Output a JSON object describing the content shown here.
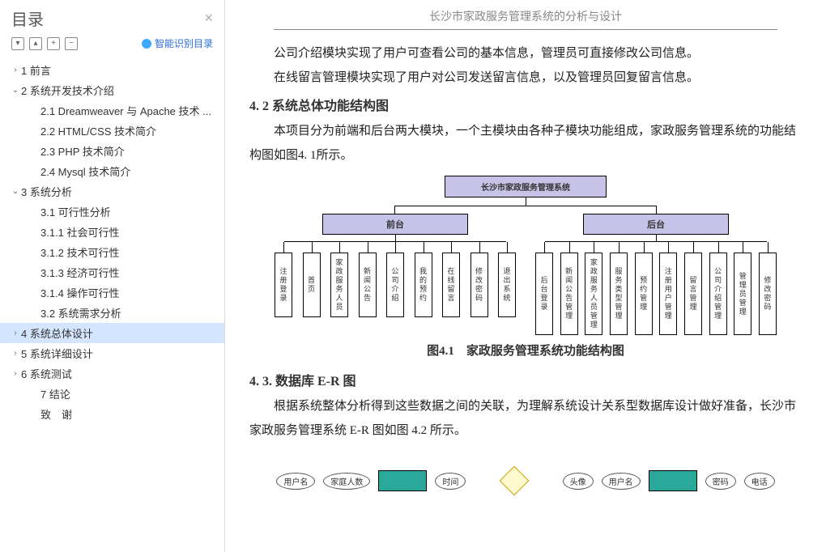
{
  "sidebar": {
    "title": "目录",
    "smart_label": "智能识别目录",
    "toc": [
      {
        "level": 0,
        "chev": ">",
        "label": "1 前言"
      },
      {
        "level": 0,
        "chev": "v",
        "label": "2 系统开发技术介绍"
      },
      {
        "level": 1,
        "chev": "",
        "label": "2.1 Dreamweaver 与 Apache 技术 ..."
      },
      {
        "level": 1,
        "chev": "",
        "label": "2.2 HTML/CSS 技术简介"
      },
      {
        "level": 1,
        "chev": "",
        "label": "2.3 PHP 技术简介"
      },
      {
        "level": 1,
        "chev": "",
        "label": "2.4 Mysql 技术简介"
      },
      {
        "level": 0,
        "chev": "v",
        "label": "3 系统分析"
      },
      {
        "level": 1,
        "chev": "",
        "label": "3.1 可行性分析"
      },
      {
        "level": 1,
        "chev": "",
        "label": "3.1.1 社会可行性"
      },
      {
        "level": 1,
        "chev": "",
        "label": "3.1.2 技术可行性"
      },
      {
        "level": 1,
        "chev": "",
        "label": "3.1.3 经济可行性"
      },
      {
        "level": 1,
        "chev": "",
        "label": "3.1.4 操作可行性"
      },
      {
        "level": 1,
        "chev": "",
        "label": "3.2 系统需求分析"
      },
      {
        "level": 0,
        "chev": ">",
        "label": "4 系统总体设计",
        "selected": true
      },
      {
        "level": 0,
        "chev": ">",
        "label": "5 系统详细设计"
      },
      {
        "level": 0,
        "chev": ">",
        "label": "6 系统测试"
      },
      {
        "level": 1,
        "chev": "",
        "label": "7 结论"
      },
      {
        "level": 1,
        "chev": "",
        "label": "致　谢"
      }
    ]
  },
  "doc": {
    "header": "长沙市家政服务管理系统的分析与设计",
    "p1": "公司介绍模块实现了用户可查看公司的基本信息，管理员可直接修改公司信息。",
    "p2": "在线留言管理模块实现了用户对公司发送留言信息，以及管理员回复留言信息。",
    "h2a": "4. 2 系统总体功能结构图",
    "p3": "本项目分为前端和后台两大模块，一个主模块由各种子模块功能组成，家政服务管理系统的功能结构图如图4. 1所示。",
    "caption1": "图4.1　家政服务管理系统功能结构图",
    "h2b": "4. 3. 数据库 E-R 图",
    "p4": "根据系统整体分析得到这些数据之间的关联，为理解系统设计关系型数据库设计做好准备，长沙市家政服务管理系统 E-R 图如图 4.2 所示。"
  },
  "chart_data": {
    "type": "diagram",
    "title": "长沙市家政服务管理系统",
    "children": [
      {
        "name": "前台",
        "children": [
          "注册登录",
          "首页",
          "家政服务人员",
          "新闻公告",
          "公司介绍",
          "我的预约",
          "在线留言",
          "修改密码",
          "退出系统"
        ]
      },
      {
        "name": "后台",
        "children": [
          "后台登录",
          "新闻公告管理",
          "家政服务人员管理",
          "服务类型管理",
          "预约管理",
          "注册用户管理",
          "留言管理",
          "公司介绍管理",
          "管理员管理",
          "修改密码"
        ]
      }
    ]
  },
  "er_labels": {
    "a": "用户名",
    "b": "家庭人数",
    "c": "时间",
    "d": "用户名",
    "e": "密码",
    "f": "电话",
    "g": "头像"
  }
}
